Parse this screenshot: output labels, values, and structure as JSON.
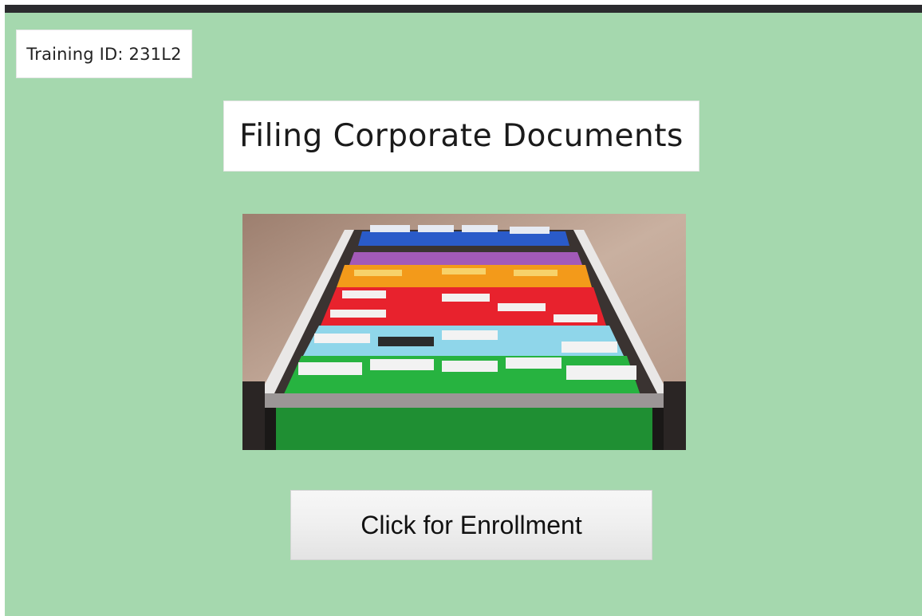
{
  "header": {
    "training_id": "Training ID: 231L2"
  },
  "main": {
    "title": "Filing Corporate Documents",
    "image": {
      "icon": "hanging-file-folders-photo"
    },
    "enroll_button_label": "Click for Enrollment"
  },
  "colors": {
    "top_bar": "#2b2b2e",
    "background": "#a5d8ae",
    "card": "#ffffff"
  }
}
